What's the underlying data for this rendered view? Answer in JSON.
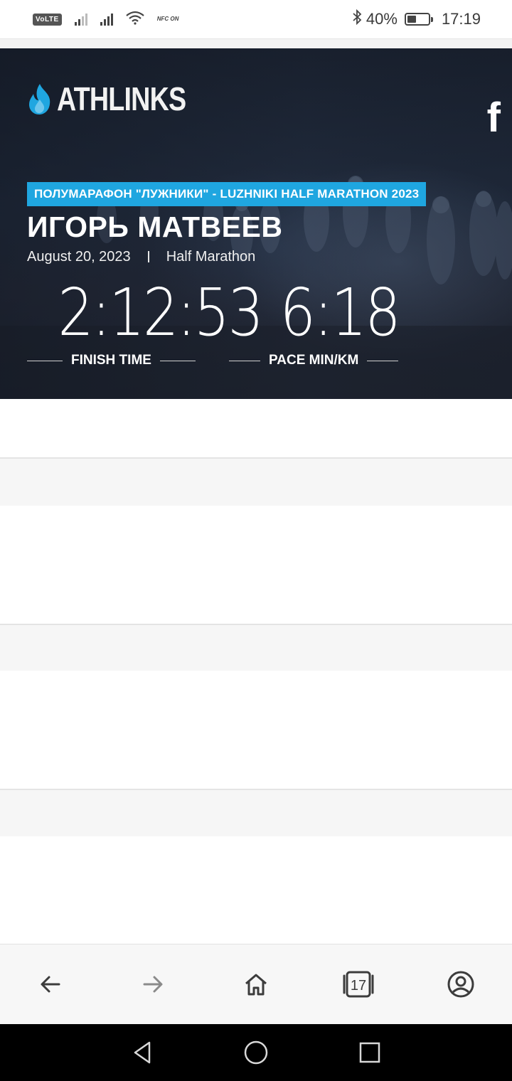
{
  "status_bar": {
    "volte": "VoLTE",
    "nfc": "NFC ON",
    "battery_pct": "40%",
    "battery_level": 0.4,
    "time": "17:19"
  },
  "hero": {
    "brand": "ATHLINKS",
    "social_icon": "facebook-icon",
    "event_name": "ПОЛУМАРАФОН \"ЛУЖНИКИ\" - LUZHNIKI HALF MARATHON 2023",
    "athlete_name": "ИГОРЬ МАТВЕЕВ",
    "date": "August 20, 2023",
    "race_type": "Half Marathon",
    "finish_time": "2:12:53",
    "finish_time_label": "FINISH TIME",
    "pace": "6:18",
    "pace_label": "PACE MIN/KM",
    "accent_color": "#1fa6e0"
  },
  "toolbar": {
    "back_icon": "arrow-left-icon",
    "forward_icon": "arrow-right-icon",
    "home_icon": "home-icon",
    "tabs_count": "17",
    "account_icon": "account-icon"
  },
  "navbar": {
    "back_icon": "triangle-back-icon",
    "home_icon": "circle-home-icon",
    "recents_icon": "square-recents-icon"
  }
}
